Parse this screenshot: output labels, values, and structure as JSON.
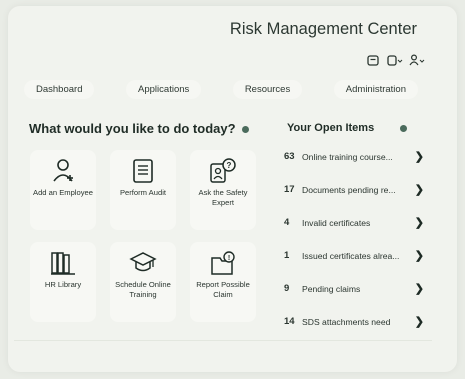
{
  "header": {
    "logo_text": "",
    "app_title": "Risk Management Center",
    "icons": [
      "inbox-icon",
      "notifications-icon",
      "user-menu-icon"
    ]
  },
  "nav": {
    "tabs": [
      {
        "label": "Dashboard"
      },
      {
        "label": "Applications"
      },
      {
        "label": "Resources"
      },
      {
        "label": "Administration"
      }
    ]
  },
  "tasks": {
    "title": "What would you like to do today?",
    "tiles": [
      {
        "label": "Add an Employee",
        "icon": "add-employee-icon"
      },
      {
        "label": "Perform Audit",
        "icon": "audit-icon"
      },
      {
        "label": "Ask the Safety Expert",
        "icon": "safety-expert-icon"
      },
      {
        "label": "HR Library",
        "icon": "library-icon"
      },
      {
        "label": "Schedule Online Training",
        "icon": "training-icon"
      },
      {
        "label": "Report Possible Claim",
        "icon": "report-claim-icon"
      }
    ]
  },
  "open_items": {
    "title": "Your Open Items",
    "items": [
      {
        "count": "63",
        "label": "Online training course..."
      },
      {
        "count": "17",
        "label": "Documents pending re..."
      },
      {
        "count": "4",
        "label": "Invalid certificates"
      },
      {
        "count": "1",
        "label": "Issued certificates alrea..."
      },
      {
        "count": "9",
        "label": "Pending claims"
      },
      {
        "count": "14",
        "label": "SDS attachments need"
      }
    ]
  },
  "colors": {
    "background": "#e9ece6",
    "panel": "#f1f3ee",
    "accent": "#4b6b5c",
    "text": "#1e2b25"
  }
}
